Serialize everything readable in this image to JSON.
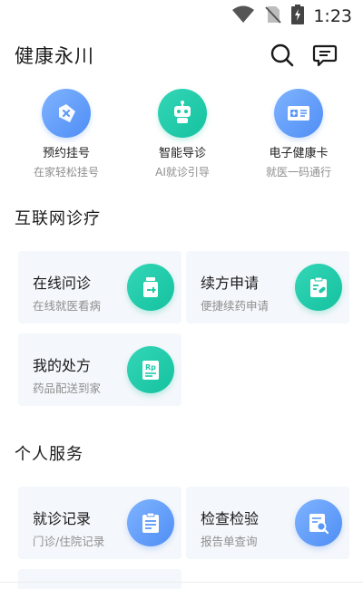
{
  "status": {
    "time": "1:23",
    "icons": [
      "wifi-icon",
      "no-sim-icon",
      "battery-charging-icon"
    ]
  },
  "header": {
    "title": "健康永川",
    "icons": [
      "search-icon",
      "message-icon"
    ]
  },
  "quick_actions": [
    {
      "label": "预约挂号",
      "sub": "在家轻松挂号",
      "icon": "ticket-icon"
    },
    {
      "label": "智能导诊",
      "sub": "AI就诊引导",
      "icon": "robot-icon"
    },
    {
      "label": "电子健康卡",
      "sub": "就医一码通行",
      "icon": "health-card-icon"
    }
  ],
  "sections": [
    {
      "title": "互联网诊疗",
      "cards": [
        {
          "title": "在线问诊",
          "sub": "在线就医看病",
          "icon": "medicine-bottle-icon",
          "color": "#1ec9a8"
        },
        {
          "title": "续方申请",
          "sub": "便捷续药申请",
          "icon": "clipboard-pill-icon",
          "color": "#1ec9a8"
        },
        {
          "title": "我的处方",
          "sub": "药品配送到家",
          "icon": "prescription-icon",
          "color": "#1ec9a8"
        }
      ]
    },
    {
      "title": "个人服务",
      "cards": [
        {
          "title": "就诊记录",
          "sub": "门诊/住院记录",
          "icon": "records-icon",
          "color": "#5b97f7"
        },
        {
          "title": "检查检验",
          "sub": "报告单查询",
          "icon": "report-search-icon",
          "color": "#5b97f7"
        }
      ]
    }
  ],
  "colors": {
    "accent_blue": "#5b97f7",
    "accent_teal": "#1ec9a8",
    "card_bg": "#f4f7fb"
  }
}
